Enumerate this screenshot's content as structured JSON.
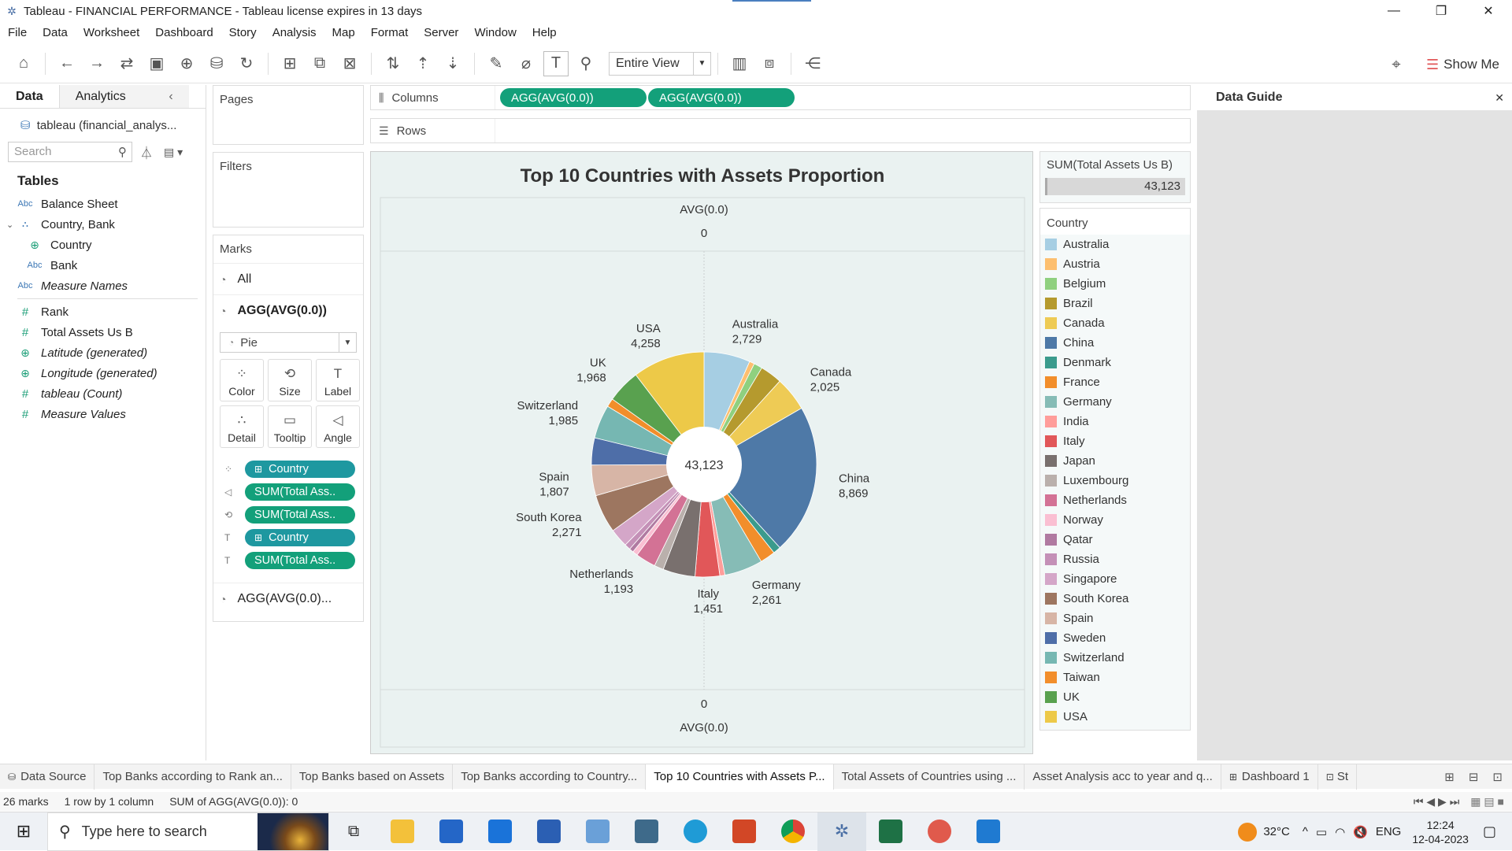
{
  "window": {
    "title": "Tableau - FINANCIAL PERFORMANCE - Tableau license expires in 13 days",
    "minimize": "—",
    "restore": "❐",
    "close": "✕"
  },
  "menu": [
    "File",
    "Data",
    "Worksheet",
    "Dashboard",
    "Story",
    "Analysis",
    "Map",
    "Format",
    "Server",
    "Window",
    "Help"
  ],
  "toolbar": {
    "fit": "Entire View",
    "show_me": "Show Me"
  },
  "datapane": {
    "tab_data": "Data",
    "tab_analytics": "Analytics",
    "datasource": "tableau (financial_analys...",
    "search_placeholder": "Search",
    "tables_heading": "Tables",
    "fields": [
      {
        "type": "Abc",
        "name": "Balance Sheet",
        "italic": false,
        "indent": 0
      },
      {
        "type": "hier",
        "name": "Country, Bank",
        "italic": false,
        "indent": 0
      },
      {
        "type": "geo",
        "name": "Country",
        "italic": false,
        "indent": 1
      },
      {
        "type": "Abc",
        "name": "Bank",
        "italic": false,
        "indent": 1
      },
      {
        "type": "Abc",
        "name": "Measure Names",
        "italic": true,
        "indent": 0
      },
      {
        "type": "#",
        "name": "Rank",
        "italic": false,
        "indent": 0
      },
      {
        "type": "#",
        "name": "Total Assets Us B",
        "italic": false,
        "indent": 0
      },
      {
        "type": "geo",
        "name": "Latitude (generated)",
        "italic": true,
        "indent": 0
      },
      {
        "type": "geo",
        "name": "Longitude (generated)",
        "italic": true,
        "indent": 0
      },
      {
        "type": "#",
        "name": "tableau (Count)",
        "italic": true,
        "indent": 0
      },
      {
        "type": "#",
        "name": "Measure Values",
        "italic": true,
        "indent": 0
      }
    ]
  },
  "pages": {
    "title": "Pages"
  },
  "filters": {
    "title": "Filters"
  },
  "marks": {
    "title": "Marks",
    "all": "All",
    "agg": "AGG(AVG(0.0))",
    "type": "Pie",
    "buttons": [
      "Color",
      "Size",
      "Label",
      "Detail",
      "Tooltip",
      "Angle"
    ],
    "pills": [
      {
        "icon": "color",
        "label": "Country",
        "kind": "dim"
      },
      {
        "icon": "angle",
        "label": "SUM(Total Ass..",
        "kind": "meas"
      },
      {
        "icon": "size",
        "label": "SUM(Total Ass..",
        "kind": "meas"
      },
      {
        "icon": "label",
        "label": "Country",
        "kind": "dim"
      },
      {
        "icon": "label",
        "label": "SUM(Total Ass..",
        "kind": "meas"
      }
    ],
    "agg2": "AGG(AVG(0.0)..."
  },
  "shelves": {
    "columns_label": "Columns",
    "columns_pills": [
      "AGG(AVG(0.0))",
      "AGG(AVG(0.0))"
    ],
    "rows_label": "Rows"
  },
  "viz": {
    "title": "Top 10 Countries with Assets Proportion",
    "top_axis_label": "AVG(0.0)",
    "top_axis_tick": "0",
    "bottom_axis_tick": "0",
    "bottom_axis_label": "AVG(0.0)",
    "center_total": "43,123"
  },
  "chart_data": {
    "type": "pie",
    "title": "Top 10 Countries with Assets Proportion",
    "total": 43123,
    "slices": [
      {
        "name": "Australia",
        "value": 2729,
        "color": "#a6cee3",
        "label": true
      },
      {
        "name": "Austria",
        "value": 300,
        "color": "#fdbf6f",
        "label": false
      },
      {
        "name": "Belgium",
        "value": 500,
        "color": "#8fd07f",
        "label": false
      },
      {
        "name": "Brazil",
        "value": 1300,
        "color": "#b59a2e",
        "label": false
      },
      {
        "name": "Canada",
        "value": 2025,
        "color": "#eecb55",
        "label": true
      },
      {
        "name": "China",
        "value": 8869,
        "color": "#4e79a7",
        "label": true
      },
      {
        "name": "Denmark",
        "value": 450,
        "color": "#3b9b8d",
        "label": false
      },
      {
        "name": "France",
        "value": 900,
        "color": "#f28e2b",
        "label": false
      },
      {
        "name": "Germany",
        "value": 2261,
        "color": "#86bcb6",
        "label": true
      },
      {
        "name": "India",
        "value": 300,
        "color": "#ff9d9a",
        "label": false
      },
      {
        "name": "Italy",
        "value": 1451,
        "color": "#e15759",
        "label": true
      },
      {
        "name": "Japan",
        "value": 1900,
        "color": "#79706e",
        "label": false
      },
      {
        "name": "Luxembourg",
        "value": 550,
        "color": "#bab0ac",
        "label": false
      },
      {
        "name": "Netherlands",
        "value": 1193,
        "color": "#d37295",
        "label": true
      },
      {
        "name": "Norway",
        "value": 300,
        "color": "#fabfd2",
        "label": false
      },
      {
        "name": "Qatar",
        "value": 250,
        "color": "#b07aa1",
        "label": false
      },
      {
        "name": "Russia",
        "value": 350,
        "color": "#c490b7",
        "label": false
      },
      {
        "name": "Singapore",
        "value": 1100,
        "color": "#d4a6c8",
        "label": false
      },
      {
        "name": "South Korea",
        "value": 2271,
        "color": "#9d7660",
        "label": true
      },
      {
        "name": "Spain",
        "value": 1807,
        "color": "#d7b5a6",
        "label": true
      },
      {
        "name": "Sweden",
        "value": 1600,
        "color": "#4e6ea8",
        "label": false
      },
      {
        "name": "Switzerland",
        "value": 1985,
        "color": "#76b7b2",
        "label": true
      },
      {
        "name": "Taiwan",
        "value": 500,
        "color": "#f28e2b",
        "label": false
      },
      {
        "name": "UK",
        "value": 1968,
        "color": "#59a14f",
        "label": true
      },
      {
        "name": "USA",
        "value": 4258,
        "color": "#edc948",
        "label": true
      }
    ],
    "slice_labels": [
      {
        "name": "Australia",
        "value": "2,729"
      },
      {
        "name": "Canada",
        "value": "2,025"
      },
      {
        "name": "China",
        "value": "8,869"
      },
      {
        "name": "Germany",
        "value": "2,261"
      },
      {
        "name": "Italy",
        "value": "1,451"
      },
      {
        "name": "Netherlands",
        "value": "1,193"
      },
      {
        "name": "South Korea",
        "value": "2,271"
      },
      {
        "name": "Spain",
        "value": "1,807"
      },
      {
        "name": "Switzerland",
        "value": "1,985"
      },
      {
        "name": "UK",
        "value": "1,968"
      },
      {
        "name": "USA",
        "value": "4,258"
      }
    ]
  },
  "sum_card": {
    "title": "SUM(Total Assets Us B)",
    "value": "43,123"
  },
  "legend": {
    "title": "Country",
    "items": [
      {
        "name": "Australia",
        "color": "#a6cee3"
      },
      {
        "name": "Austria",
        "color": "#fdbf6f"
      },
      {
        "name": "Belgium",
        "color": "#8fd07f"
      },
      {
        "name": "Brazil",
        "color": "#b59a2e"
      },
      {
        "name": "Canada",
        "color": "#eecb55"
      },
      {
        "name": "China",
        "color": "#4e79a7"
      },
      {
        "name": "Denmark",
        "color": "#3b9b8d"
      },
      {
        "name": "France",
        "color": "#f28e2b"
      },
      {
        "name": "Germany",
        "color": "#86bcb6"
      },
      {
        "name": "India",
        "color": "#ff9d9a"
      },
      {
        "name": "Italy",
        "color": "#e15759"
      },
      {
        "name": "Japan",
        "color": "#79706e"
      },
      {
        "name": "Luxembourg",
        "color": "#bab0ac"
      },
      {
        "name": "Netherlands",
        "color": "#d37295"
      },
      {
        "name": "Norway",
        "color": "#fabfd2"
      },
      {
        "name": "Qatar",
        "color": "#b07aa1"
      },
      {
        "name": "Russia",
        "color": "#c490b7"
      },
      {
        "name": "Singapore",
        "color": "#d4a6c8"
      },
      {
        "name": "South Korea",
        "color": "#9d7660"
      },
      {
        "name": "Spain",
        "color": "#d7b5a6"
      },
      {
        "name": "Sweden",
        "color": "#4e6ea8"
      },
      {
        "name": "Switzerland",
        "color": "#76b7b2"
      },
      {
        "name": "Taiwan",
        "color": "#f28e2b"
      },
      {
        "name": "UK",
        "color": "#59a14f"
      },
      {
        "name": "USA",
        "color": "#edc948"
      }
    ]
  },
  "data_guide": {
    "title": "Data Guide",
    "close": "✕"
  },
  "sheet_tabs": [
    {
      "label": "Data Source",
      "active": false
    },
    {
      "label": "Top Banks according to Rank an...",
      "active": false
    },
    {
      "label": "Top Banks based on Assets",
      "active": false
    },
    {
      "label": "Top Banks according to Country...",
      "active": false
    },
    {
      "label": "Top 10 Countries with Assets P...",
      "active": true
    },
    {
      "label": "Total Assets of Countries using ...",
      "active": false
    },
    {
      "label": "Asset Analysis acc to year and q...",
      "active": false
    },
    {
      "label": "Dashboard 1",
      "active": false
    },
    {
      "label": "St",
      "active": false
    }
  ],
  "status": {
    "marks": "26 marks",
    "dims": "1 row by 1 column",
    "sum": "SUM of AGG(AVG(0.0)): 0"
  },
  "taskbar": {
    "search_placeholder": "Type here to search",
    "temp": "32°C",
    "lang": "ENG",
    "time": "12:24",
    "date": "12-04-2023"
  }
}
